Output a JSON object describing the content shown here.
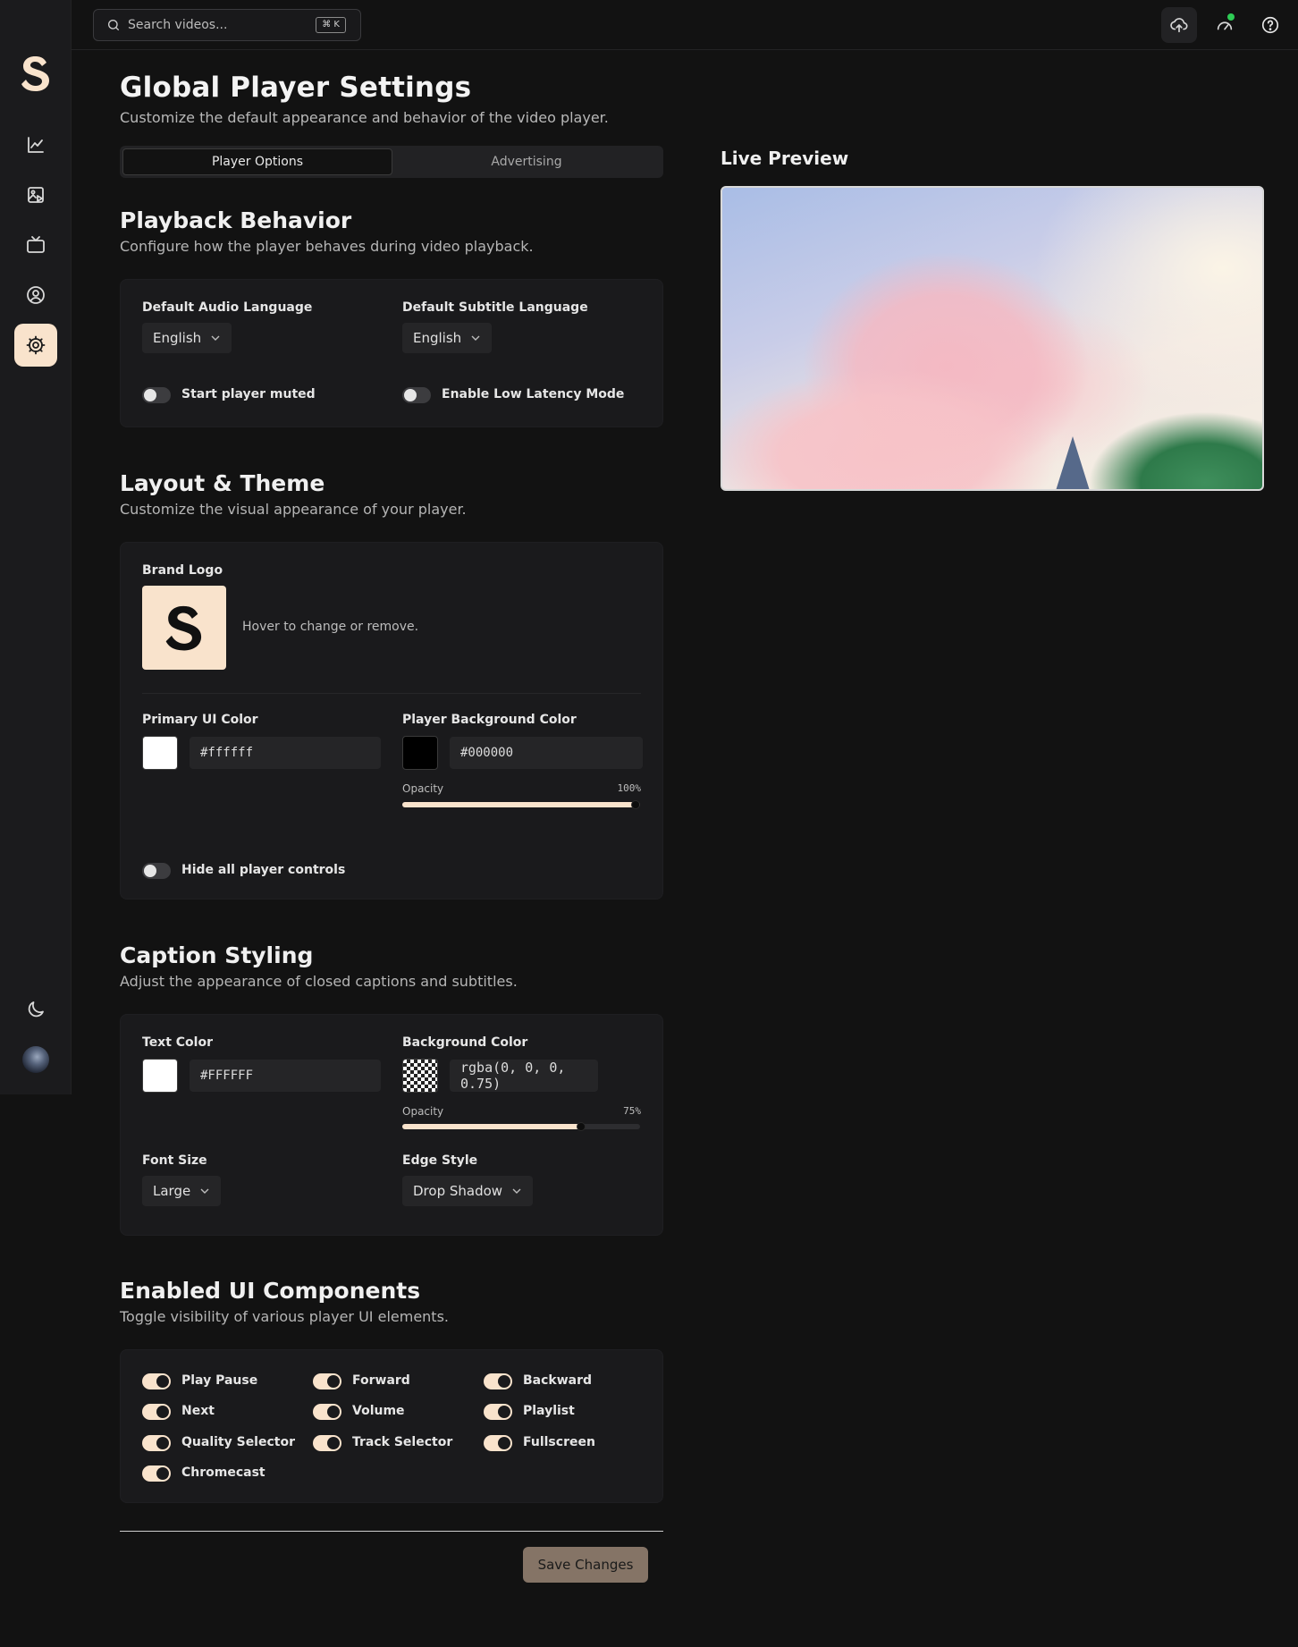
{
  "app": {
    "logo_letter": "S"
  },
  "search": {
    "placeholder": "Search videos...",
    "shortcut": "⌘ K"
  },
  "sidebar": {
    "items": [
      {
        "name": "analytics",
        "icon": "line-chart-icon"
      },
      {
        "name": "media",
        "icon": "image-play-icon"
      },
      {
        "name": "channels",
        "icon": "tv-icon"
      },
      {
        "name": "account",
        "icon": "user-circle-icon"
      },
      {
        "name": "settings",
        "icon": "gear-icon",
        "active": true
      }
    ],
    "footer": [
      {
        "icon": "moon-icon"
      },
      {
        "icon": "avatar"
      }
    ]
  },
  "topbar_icons": [
    "upload-cloud-icon",
    "gauge-icon",
    "help-icon"
  ],
  "page": {
    "title": "Global Player Settings",
    "subtitle": "Customize the default appearance and behavior of the video player."
  },
  "tabs": [
    {
      "label": "Player Options",
      "active": true
    },
    {
      "label": "Advertising",
      "active": false
    }
  ],
  "playback": {
    "title": "Playback Behavior",
    "subtitle": "Configure how the player behaves during video playback.",
    "audio_label": "Default Audio Language",
    "audio_value": "English",
    "subtitle_label": "Default Subtitle Language",
    "subtitle_value": "English",
    "muted_label": "Start player muted",
    "muted_on": false,
    "latency_label": "Enable Low Latency Mode",
    "latency_on": false
  },
  "layout": {
    "title": "Layout & Theme",
    "subtitle": "Customize the visual appearance of your player.",
    "brand_label": "Brand Logo",
    "brand_hint": "Hover to change or remove.",
    "primary_label": "Primary UI Color",
    "primary_value": "#ffffff",
    "bg_label": "Player Background Color",
    "bg_value": "#000000",
    "opacity_label": "Opacity",
    "opacity_value": "100%",
    "opacity": 1.0,
    "hide_label": "Hide all player controls",
    "hide_on": false
  },
  "caption": {
    "title": "Caption Styling",
    "subtitle": "Adjust the appearance of closed captions and subtitles.",
    "text_color_label": "Text Color",
    "text_color_value": "#FFFFFF",
    "bg_color_label": "Background Color",
    "bg_color_value": "rgba(0, 0, 0, 0.75)",
    "opacity_label": "Opacity",
    "opacity_value": "75%",
    "opacity": 0.75,
    "font_size_label": "Font Size",
    "font_size_value": "Large",
    "edge_label": "Edge Style",
    "edge_value": "Drop Shadow"
  },
  "components": {
    "title": "Enabled UI Components",
    "subtitle": "Toggle visibility of various player UI elements.",
    "items": [
      {
        "label": "Play Pause",
        "on": true
      },
      {
        "label": "Forward",
        "on": true
      },
      {
        "label": "Backward",
        "on": true
      },
      {
        "label": "Next",
        "on": true
      },
      {
        "label": "Volume",
        "on": true
      },
      {
        "label": "Playlist",
        "on": true
      },
      {
        "label": "Quality Selector",
        "on": true
      },
      {
        "label": "Track Selector",
        "on": true
      },
      {
        "label": "Fullscreen",
        "on": true
      },
      {
        "label": "Chromecast",
        "on": true
      }
    ]
  },
  "save_label": "Save Changes",
  "preview": {
    "title": "Live Preview"
  },
  "colors": {
    "accent": "#f9e3cc",
    "background": "#121212",
    "card": "#1a1a1c",
    "online": "#2ecc55",
    "save_button": "#857466"
  }
}
